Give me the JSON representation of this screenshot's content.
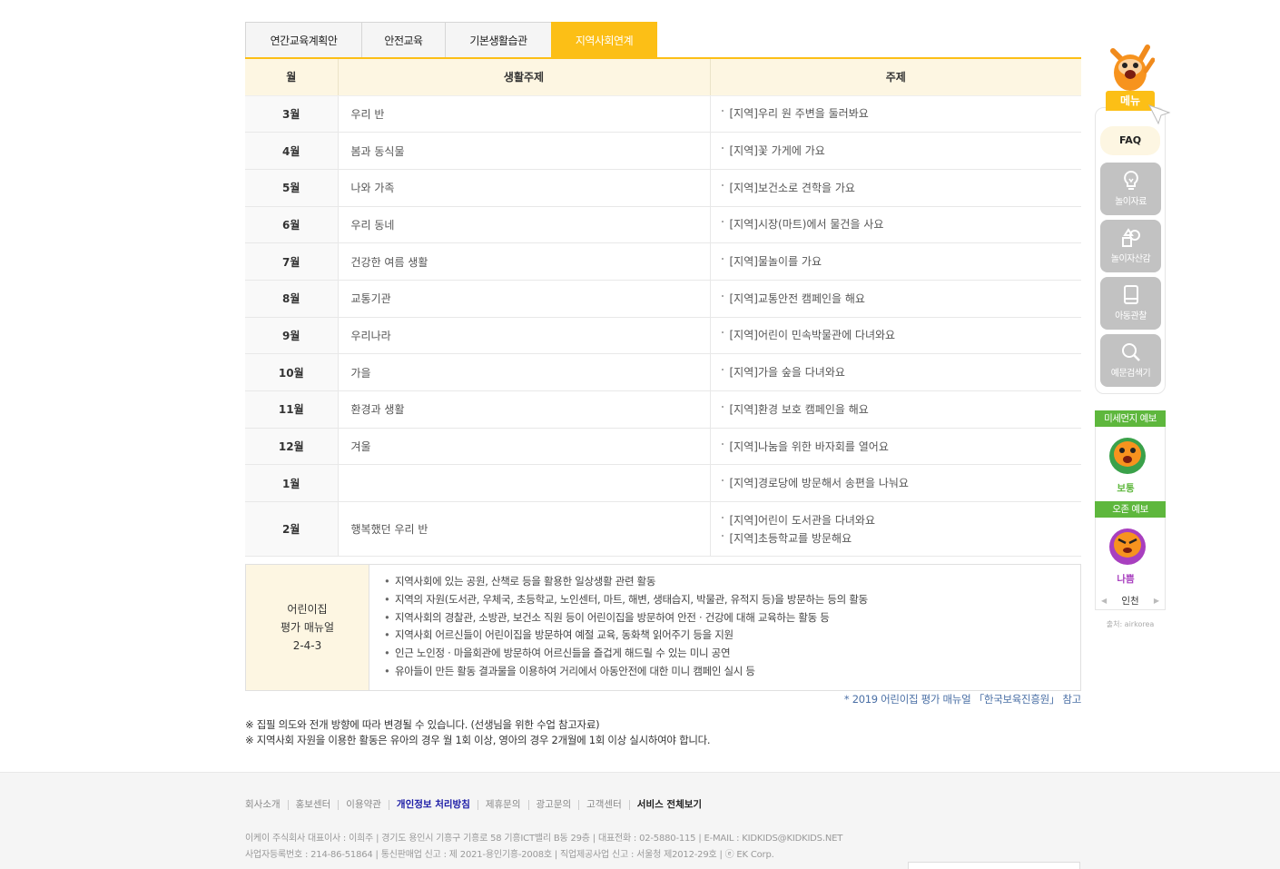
{
  "tabs": [
    "연간교육계획안",
    "안전교육",
    "기본생활습관",
    "지역사회연계"
  ],
  "active_tab_index": 3,
  "accent_color": "#fcbf16",
  "table": {
    "headers": [
      "월",
      "생활주제",
      "주제"
    ],
    "rows": [
      {
        "month": "3월",
        "life": "우리 반",
        "topics": [
          "[지역]우리 원 주변을 둘러봐요"
        ]
      },
      {
        "month": "4월",
        "life": "봄과 동식물",
        "topics": [
          "[지역]꽃 가게에 가요"
        ]
      },
      {
        "month": "5월",
        "life": "나와 가족",
        "topics": [
          "[지역]보건소로 견학을 가요"
        ]
      },
      {
        "month": "6월",
        "life": "우리 동네",
        "topics": [
          "[지역]시장(마트)에서 물건을 사요"
        ]
      },
      {
        "month": "7월",
        "life": "건강한 여름 생활",
        "topics": [
          "[지역]물놀이를 가요"
        ]
      },
      {
        "month": "8월",
        "life": "교통기관",
        "topics": [
          "[지역]교통안전 캠페인을 해요"
        ]
      },
      {
        "month": "9월",
        "life": "우리나라",
        "topics": [
          "[지역]어린이 민속박물관에 다녀와요"
        ]
      },
      {
        "month": "10월",
        "life": "가을",
        "topics": [
          "[지역]가을 숲을 다녀와요"
        ]
      },
      {
        "month": "11월",
        "life": "환경과 생활",
        "topics": [
          "[지역]환경 보호 캠페인을 해요"
        ]
      },
      {
        "month": "12월",
        "life": "겨울",
        "topics": [
          "[지역]나눔을 위한 바자회를 열어요"
        ]
      },
      {
        "month": "1월",
        "life": "",
        "topics": [
          "[지역]경로당에 방문해서 송편을 나눠요"
        ]
      },
      {
        "month": "2월",
        "life": "행복했던 우리 반",
        "topics": [
          "[지역]어린이 도서관을 다녀와요",
          "[지역]초등학교를 방문해요"
        ]
      }
    ]
  },
  "note": {
    "title_lines": [
      "어린이집",
      "평가 매뉴얼",
      "2-4-3"
    ],
    "items": [
      "지역사회에 있는 공원, 산책로 등을 활용한 일상생활 관련 활동",
      "지역의 자원(도서관, 우체국, 초등학교, 노인센터, 마트, 해변, 생태습지, 박물관, 유적지 등)을 방문하는 등의 활동",
      "지역사회의 경찰관, 소방관, 보건소 직원 등이 어린이집을 방문하여 안전 · 건강에 대해 교육하는 활동 등",
      "지역사회 어르신들이 어린이집을 방문하여 예절 교육, 동화책 읽어주기 등을 지원",
      "인근 노인정 · 마을회관에 방문하여 어르신들을 즐겁게 해드릴 수 있는 미니 공연",
      "유아들이 만든 활동 결과물을 이용하여 거리에서 아동안전에 대한 미니 캠페인 실시 등"
    ]
  },
  "source_note": "* 2019 어린이집 평가 매뉴얼 「한국보육진흥원」 참고",
  "remarks": [
    "※ 집필 의도와 전개 방향에 따라 변경될 수 있습니다. (선생님을 위한 수업 참고자료)",
    "※ 지역사회 자원을 이용한 활동은 유아의 경우 월 1회 이상, 영아의 경우 2개월에 1회 이상 실시하여야 합니다."
  ],
  "quick_menu": {
    "badge": "메뉴",
    "faq": "FAQ",
    "buttons": [
      {
        "label": "놀이자료",
        "icon": "lightbulb-icon"
      },
      {
        "label": "놀이자산감",
        "icon": "shapes-icon"
      },
      {
        "label": "아동관찰",
        "icon": "notebook-icon"
      },
      {
        "label": "예문검색기",
        "icon": "search-icon"
      }
    ]
  },
  "weather": {
    "dust_title": "미세먼지 예보",
    "dust_status": "보통",
    "dust_color": "#5eb73d",
    "ozone_title": "오존 예보",
    "ozone_status": "나쁨",
    "ozone_color": "#a83fbf",
    "region": "인천",
    "source": "출처: airkorea"
  },
  "footer": {
    "links": [
      "회사소개",
      "홍보센터",
      "이용약관",
      "개인정보 처리방침",
      "제휴문의",
      "광고문의",
      "고객센터",
      "서비스 전체보기"
    ],
    "info_lines": [
      "이케이 주식회사 대표이사 : 이희주 | 경기도 용인시 기흥구 기흥로 58 기흥ICT밸리 B동 29층 | 대표전화 : 02-5880-115 | E-MAIL : KIDKIDS@KIDKIDS.NET",
      "사업자등록번호 : 214-86-51864 | 통신판매업 신고 : 제 2021-용인기흥-2008호 | 직업제공사업 신고 : 서울청 제2012-29호 | ⓔ EK Corp."
    ]
  }
}
